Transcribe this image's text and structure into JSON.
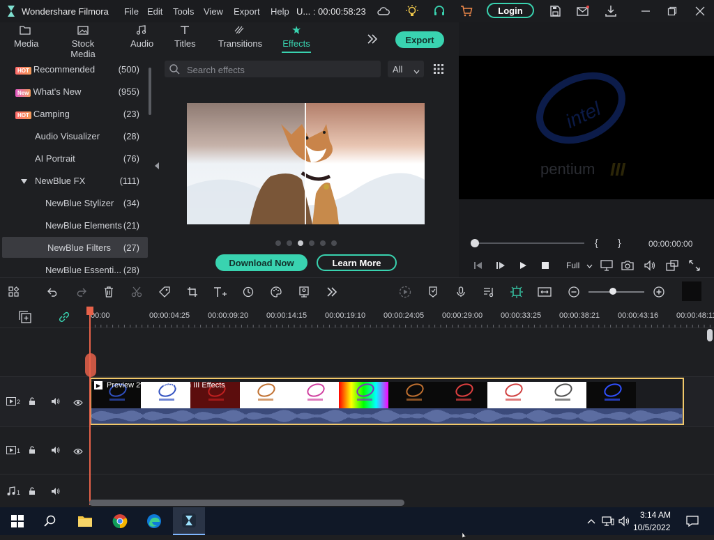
{
  "titlebar": {
    "app_name": "Wondershare Filmora",
    "menus": [
      "File",
      "Edit",
      "Tools",
      "View",
      "Export",
      "Help"
    ],
    "project_label": "U... : 00:00:58:23",
    "login_label": "Login"
  },
  "media_tabs": [
    {
      "label": "Media",
      "icon": "folder-icon"
    },
    {
      "label": "Stock Media",
      "icon": "stock-media-icon"
    },
    {
      "label": "Audio",
      "icon": "music-icon"
    },
    {
      "label": "Titles",
      "icon": "titles-icon"
    },
    {
      "label": "Transitions",
      "icon": "transitions-icon"
    },
    {
      "label": "Effects",
      "icon": "effects-icon",
      "active": true
    }
  ],
  "export_label": "Export",
  "categories": [
    {
      "badge": "HOT",
      "label": "Recommended",
      "count": "(500)",
      "indent": 0
    },
    {
      "badge": "New",
      "label": "What's New",
      "count": "(955)",
      "indent": 0
    },
    {
      "badge": "HOT",
      "label": "Camping",
      "count": "(23)",
      "indent": 0
    },
    {
      "badge": "",
      "label": "Audio Visualizer",
      "count": "(28)",
      "indent": 1
    },
    {
      "badge": "",
      "label": "AI Portrait",
      "count": "(76)",
      "indent": 1
    },
    {
      "badge": "",
      "label": "NewBlue FX",
      "count": "(111)",
      "indent": 1,
      "expanded": true
    },
    {
      "badge": "",
      "label": "NewBlue Stylizer",
      "count": "(34)",
      "indent": 2
    },
    {
      "badge": "",
      "label": "NewBlue Elements",
      "count": "(21)",
      "indent": 2
    },
    {
      "badge": "",
      "label": "NewBlue Filters",
      "count": "(27)",
      "indent": 2,
      "selected": true
    },
    {
      "badge": "",
      "label": "NewBlue Essenti...",
      "count": "(28)",
      "indent": 2
    }
  ],
  "search": {
    "placeholder": "Search effects",
    "filter_value": "All"
  },
  "promo": {
    "download_label": "Download Now",
    "learn_label": "Learn More",
    "pages": 6,
    "active_page": 3
  },
  "viewer": {
    "mark_in": "{",
    "mark_out": "}",
    "timecode": "00:00:00:00",
    "quality": "Full",
    "progress": 0,
    "logo_text": "pentium"
  },
  "ruler_ticks": [
    "00:00",
    "00:00:04:25",
    "00:00:09:20",
    "00:00:14:15",
    "00:00:19:10",
    "00:00:24:05",
    "00:00:29:00",
    "00:00:33:25",
    "00:00:38:21",
    "00:00:43:16",
    "00:00:48:11"
  ],
  "tracks": [
    {
      "type": "video",
      "index": "2"
    },
    {
      "type": "video",
      "index": "1"
    },
    {
      "type": "audio",
      "index": "1"
    }
  ],
  "clip": {
    "title": "Preview 2v Intel Pentium III Effects"
  },
  "taskbar": {
    "time": "3:14 AM",
    "date": "10/5/2022"
  },
  "colors": {
    "accent": "#39d3b0",
    "clip_border": "#f1c86a",
    "playhead": "#e8624a",
    "audio": "#3b4a7a"
  }
}
